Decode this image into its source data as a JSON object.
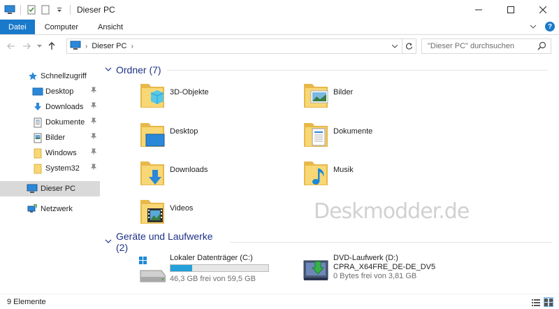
{
  "window": {
    "title": "Dieser PC"
  },
  "ribbon": {
    "tabs": [
      {
        "label": "Datei"
      },
      {
        "label": "Computer"
      },
      {
        "label": "Ansicht"
      }
    ],
    "help": "?"
  },
  "address": {
    "crumb": "Dieser PC",
    "search_placeholder": "\"Dieser PC\" durchsuchen"
  },
  "sidebar": {
    "items": [
      {
        "label": "Schnellzugriff",
        "icon": "star-icon",
        "pinned": false
      },
      {
        "label": "Desktop",
        "icon": "desktop-icon",
        "pinned": true
      },
      {
        "label": "Downloads",
        "icon": "download-icon",
        "pinned": true
      },
      {
        "label": "Dokumente",
        "icon": "document-icon",
        "pinned": true
      },
      {
        "label": "Bilder",
        "icon": "pictures-icon",
        "pinned": true
      },
      {
        "label": "Windows",
        "icon": "folder-icon",
        "pinned": true
      },
      {
        "label": "System32",
        "icon": "folder-icon",
        "pinned": true
      },
      {
        "label": "Dieser PC",
        "icon": "computer-icon",
        "pinned": false,
        "selected": true
      },
      {
        "label": "Netzwerk",
        "icon": "network-icon",
        "pinned": false
      }
    ]
  },
  "folders": {
    "title": "Ordner (7)",
    "items": [
      {
        "label": "3D-Objekte",
        "icon": "3d-objects-folder-icon"
      },
      {
        "label": "Bilder",
        "icon": "pictures-folder-icon"
      },
      {
        "label": "Desktop",
        "icon": "desktop-folder-icon"
      },
      {
        "label": "Dokumente",
        "icon": "documents-folder-icon"
      },
      {
        "label": "Downloads",
        "icon": "downloads-folder-icon"
      },
      {
        "label": "Musik",
        "icon": "music-folder-icon"
      },
      {
        "label": "Videos",
        "icon": "videos-folder-icon"
      }
    ]
  },
  "drives": {
    "title": "Geräte und Laufwerke (2)",
    "items": [
      {
        "label": "Lokaler Datenträger (C:)",
        "free": "46,3 GB frei von 59,5 GB",
        "used_fraction": 0.22,
        "icon": "hard-drive-icon"
      },
      {
        "label": "DVD-Laufwerk (D:)",
        "volume": "CPRA_X64FRE_DE-DE_DV5",
        "free": "0 Bytes frei von 3,81 GB",
        "icon": "dvd-drive-icon"
      }
    ]
  },
  "watermark": "Deskmodder.de",
  "status": {
    "count": "9 Elemente"
  },
  "colors": {
    "accent": "#1979ca",
    "group_title": "#1e3287",
    "selection": "#d9d9d9",
    "progress": "#26a0da"
  }
}
